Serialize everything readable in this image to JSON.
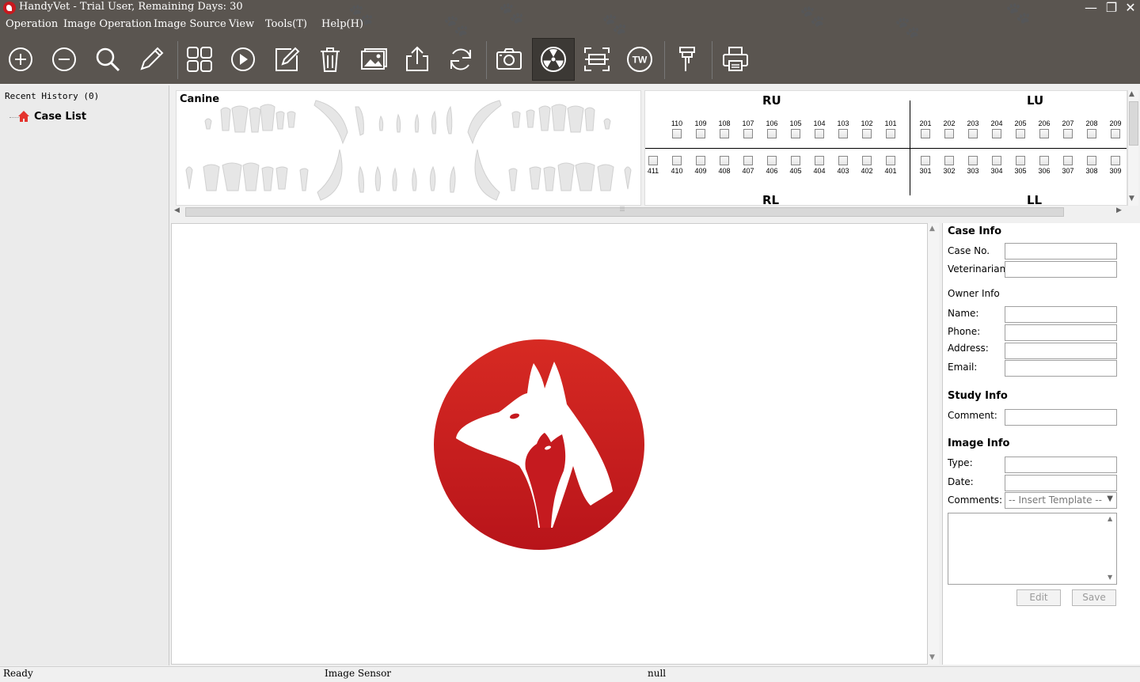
{
  "window": {
    "title": "HandyVet - Trial User, Remaining Days: 30",
    "minimize": "—",
    "maximize": "❐",
    "close": "✕"
  },
  "menu": [
    {
      "label": "Operation"
    },
    {
      "label": "Image Operation"
    },
    {
      "label": "Image Source"
    },
    {
      "label": "View"
    },
    {
      "label": "Tools(T)"
    },
    {
      "label": "Help(H)"
    }
  ],
  "toolbar": [
    {
      "icon": "zoom-in-icon",
      "active": false
    },
    {
      "icon": "zoom-out-icon",
      "active": false
    },
    {
      "icon": "magnifier-icon",
      "active": false
    },
    {
      "icon": "pencil-icon",
      "active": false
    },
    {
      "icon": "grid-layout-icon",
      "active": false
    },
    {
      "icon": "play-icon",
      "active": false
    },
    {
      "icon": "edit-icon",
      "active": false
    },
    {
      "icon": "trash-icon",
      "active": false
    },
    {
      "icon": "image-gallery-icon",
      "active": false
    },
    {
      "icon": "export-icon",
      "active": false
    },
    {
      "icon": "refresh-icon",
      "active": false
    },
    {
      "icon": "camera-icon",
      "active": false
    },
    {
      "icon": "radiation-icon",
      "active": true
    },
    {
      "icon": "scanner-icon",
      "active": false
    },
    {
      "icon": "tw-icon",
      "active": false,
      "text": "TW"
    },
    {
      "icon": "sensor-icon",
      "active": false
    },
    {
      "icon": "printer-icon",
      "active": false
    }
  ],
  "left_panel": {
    "recent_history": "Recent History (0)",
    "case_list": "Case List"
  },
  "dental_chart": {
    "label": "Canine"
  },
  "tooth_selector": {
    "quadrants": {
      "ru": "RU",
      "lu": "LU",
      "rl": "RL",
      "ll": "LL"
    },
    "upper_right": [
      "110",
      "109",
      "108",
      "107",
      "106",
      "105",
      "104",
      "103",
      "102",
      "101"
    ],
    "upper_left": [
      "201",
      "202",
      "203",
      "204",
      "205",
      "206",
      "207",
      "208",
      "209"
    ],
    "lower_right": [
      "411",
      "410",
      "409",
      "408",
      "407",
      "406",
      "405",
      "404",
      "403",
      "402",
      "401"
    ],
    "lower_left": [
      "301",
      "302",
      "303",
      "304",
      "305",
      "306",
      "307",
      "308",
      "309"
    ]
  },
  "info_panel": {
    "case_info": "Case Info",
    "case_no": "Case No.",
    "veterinarian": "Veterinarian:",
    "owner_info": "Owner Info",
    "name": "Name:",
    "phone": "Phone:",
    "address": "Address:",
    "email": "Email:",
    "study_info": "Study Info",
    "comment": "Comment:",
    "image_info": "Image Info",
    "type": "Type:",
    "date": "Date:",
    "comments": "Comments:",
    "template_placeholder": "-- Insert Template --",
    "edit_button": "Edit",
    "save_button": "Save"
  },
  "status": {
    "state": "Ready",
    "source": "Image Sensor",
    "value": "null"
  },
  "colors": {
    "toolbar_bg": "#5a5550",
    "brand_red": "#c8191e"
  }
}
